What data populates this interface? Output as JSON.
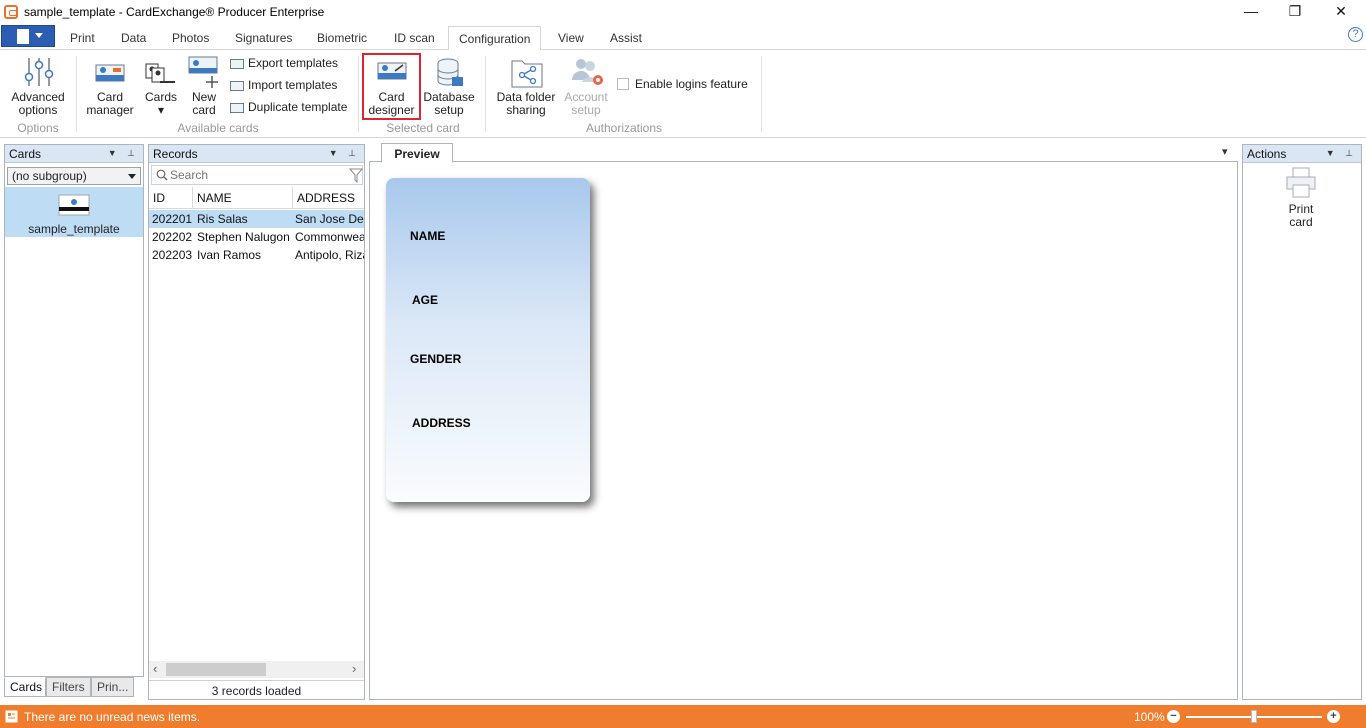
{
  "window": {
    "title": "sample_template - CardExchange® Producer Enterprise",
    "minimize": "—",
    "restore": "❐",
    "close": "✕"
  },
  "tabs": [
    {
      "label": "Print"
    },
    {
      "label": "Data"
    },
    {
      "label": "Photos"
    },
    {
      "label": "Signatures"
    },
    {
      "label": "Biometric"
    },
    {
      "label": "ID scan"
    },
    {
      "label": "Configuration",
      "active": true
    },
    {
      "label": "View"
    },
    {
      "label": "Assist"
    }
  ],
  "help": "?",
  "ribbon": {
    "options": {
      "advanced_options_line1": "Advanced",
      "advanced_options_line2": "options",
      "group": "Options"
    },
    "available_cards": {
      "card_manager_line1": "Card",
      "card_manager_line2": "manager",
      "cards": "Cards",
      "cards_arrow": "▾",
      "new_card_line1": "New",
      "new_card_line2": "card",
      "export_templates": "Export templates",
      "import_templates": "Import templates",
      "duplicate_template": "Duplicate template",
      "group": "Available cards"
    },
    "selected_card": {
      "card_designer_line1": "Card",
      "card_designer_line2": "designer",
      "database_setup_line1": "Database",
      "database_setup_line2": "setup",
      "group": "Selected card"
    },
    "authorizations": {
      "data_folder_sharing_line1": "Data folder",
      "data_folder_sharing_line2": "sharing",
      "account_setup_line1": "Account",
      "account_setup_line2": "setup",
      "enable_logins": "Enable logins feature",
      "group": "Authorizations"
    }
  },
  "cards_panel": {
    "title": "Cards",
    "pin": "▼ ⊥",
    "subgroup": "(no subgroup)",
    "template_name": "sample_template",
    "bottom_tabs": [
      "Cards",
      "Filters",
      "Prin..."
    ]
  },
  "records_panel": {
    "title": "Records",
    "pin": "▼ ⊥",
    "search_placeholder": "Search",
    "columns": [
      "ID",
      "NAME",
      "ADDRESS"
    ],
    "rows": [
      {
        "id": "202201",
        "name": "Ris Salas",
        "address": "San Jose Del"
      },
      {
        "id": "202202",
        "name": "Stephen Nalugon",
        "address": "Commonwea"
      },
      {
        "id": "202203",
        "name": "Ivan Ramos",
        "address": "Antipolo, Riza"
      }
    ],
    "scroll_left": "‹",
    "scroll_right": "›",
    "status": "3 records loaded"
  },
  "preview": {
    "tab": "Preview",
    "menu": "▾",
    "card_fields": [
      "NAME",
      "AGE",
      "GENDER",
      "ADDRESS"
    ]
  },
  "actions_panel": {
    "title": "Actions",
    "pin": "▼ ⊥",
    "print_card_line1": "Print",
    "print_card_line2": "card"
  },
  "statusbar": {
    "news": "There are no unread news items.",
    "zoom": "100%",
    "zoom_out": "−",
    "zoom_in": "+",
    "zoom_level": 0.5
  }
}
